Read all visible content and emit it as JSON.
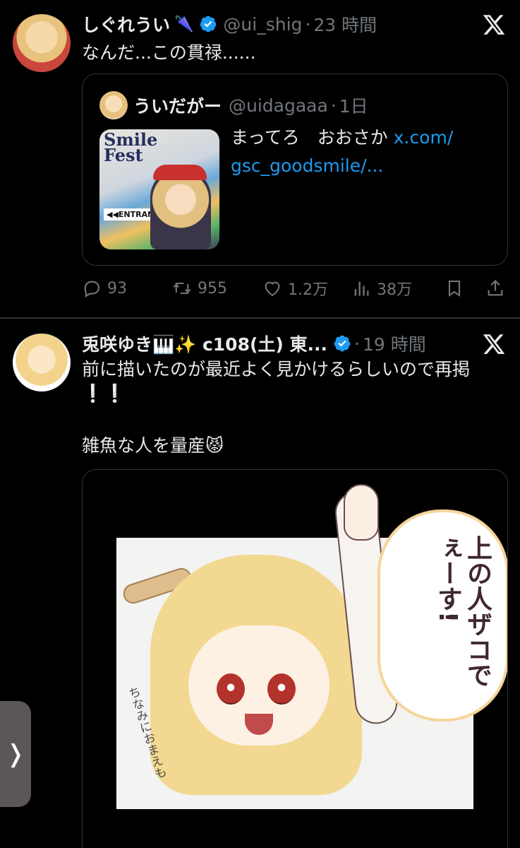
{
  "tweet1": {
    "author_name": "しぐれうい",
    "author_emoji": "🌂",
    "handle": "@ui_shig",
    "time": "23 時間",
    "text": "なんだ...この貫禄......",
    "quote": {
      "author_name": "ういだがー",
      "handle": "@uidagaaa",
      "time": "1日",
      "text": "まってろ　おおさか",
      "link_line1": "x.com/",
      "link_line2": "gsc_goodsmile/...",
      "thumb_text_1": "Smile",
      "thumb_text_2": "Fest",
      "thumb_entrance": "◀◀ENTRANCE"
    },
    "actions": {
      "replies": "93",
      "retweets": "955",
      "likes": "1.2万",
      "views": "38万"
    }
  },
  "tweet2": {
    "author_name": "兎咲ゆき🎹✨ c108(土) 東...",
    "handle": "",
    "time": "19 時間",
    "text_line1": "前に描いたのが最近よく見かけるらしいので再掲",
    "text_line2": "❕❕",
    "text_line3": "雑魚な人を量産😾",
    "image": {
      "bubble_text": "上の人ザコでぇーす!",
      "side_note": "ちなみにおまえも"
    }
  },
  "ui": {
    "side_tab_glyph": "❭",
    "accent": "#1d9bf0",
    "muted": "#71767b",
    "background": "#000000"
  }
}
